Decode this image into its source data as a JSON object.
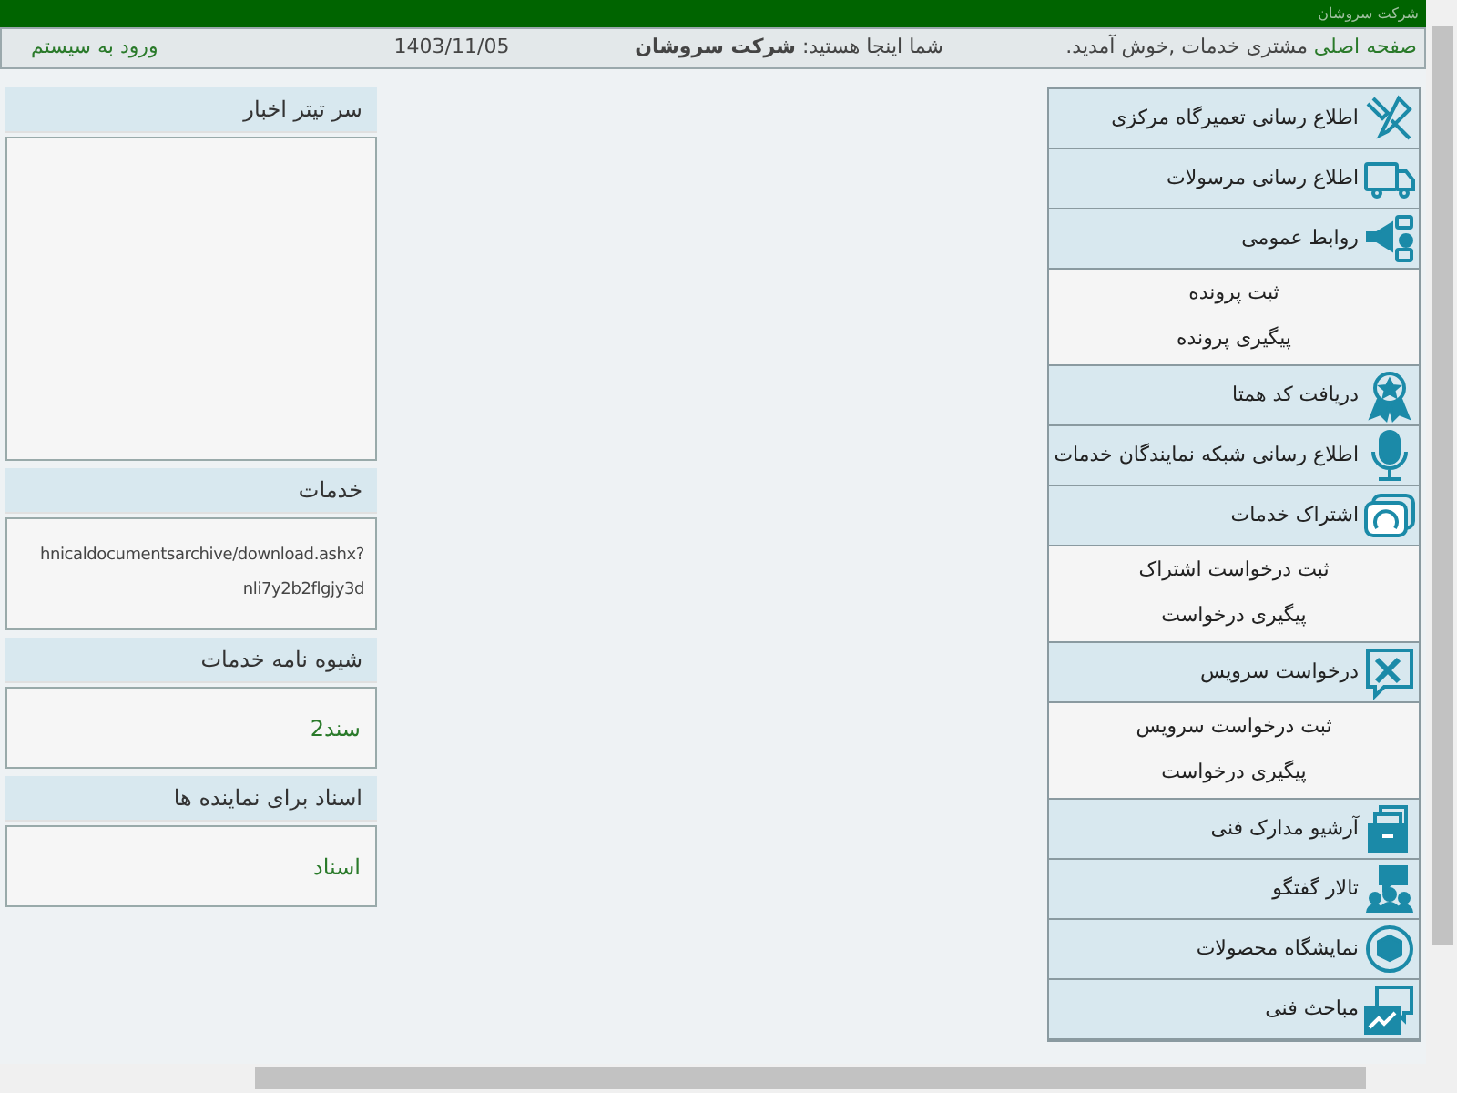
{
  "top_bar": {
    "title": "شرکت سروشان"
  },
  "header": {
    "home_link": "صفحه اصلی",
    "welcome": "مشتری خدمات ,خوش آمدید.",
    "location": "شما اینجا هستید: **شرکت سروشان**",
    "date": "1403/11/05",
    "login_link": "ورود به سیستم"
  },
  "menu": [
    {
      "label": "اطلاع رسانی تعمیرگاه مرکزی"
    },
    {
      "label": "اطلاع رسانی مرسولات"
    },
    {
      "label": "روابط عمومی",
      "children": [
        "ثبت پرونده",
        "پیگیری پرونده"
      ]
    },
    {
      "label": "دریافت کد همتا"
    },
    {
      "label": "اطلاع رسانی شبکه نمایندگان خدمات"
    },
    {
      "label": "اشتراک خدمات",
      "children": [
        "ثبت درخواست اشتراک",
        "پیگیری درخواست"
      ]
    },
    {
      "label": "درخواست سرویس",
      "children": [
        "ثبت درخواست سرویس",
        "پیگیری درخواست"
      ]
    },
    {
      "label": "آرشیو مدارک فنی"
    },
    {
      "label": "تالار گفتگو"
    },
    {
      "label": "نمایشگاه محصولات"
    },
    {
      "label": "مباحث فنی"
    }
  ],
  "panels": [
    {
      "title": "سر تیتر اخبار",
      "kind": "empty"
    },
    {
      "title": "خدمات",
      "kind": "url",
      "lines": [
        "hnicaldocumentsarchive/download.ashx?",
        "nli7y2b2flgjy3d"
      ]
    },
    {
      "title": "شیوه نامه خدمات",
      "kind": "link",
      "lines": [
        "سند2"
      ]
    },
    {
      "title": "اسناد برای نماینده ها",
      "kind": "link",
      "lines": [
        "اسناد"
      ]
    }
  ]
}
